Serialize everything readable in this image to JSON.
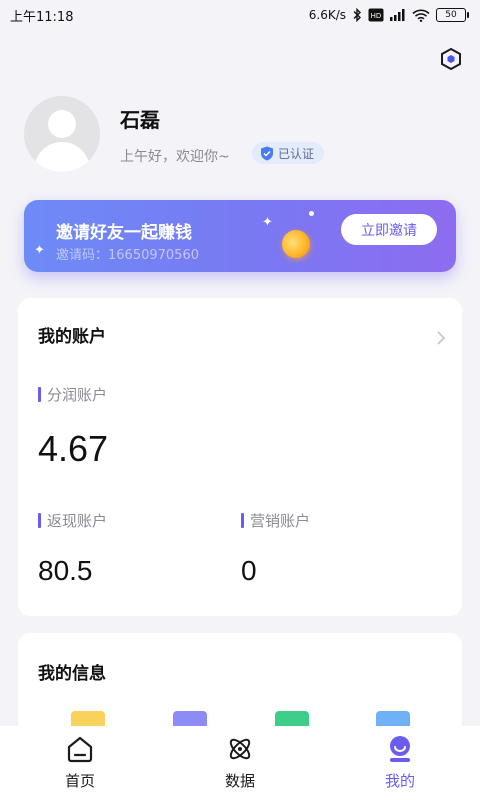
{
  "status_bar": {
    "time": "上午11:18",
    "net_speed": "6.6K/s",
    "battery": "50",
    "volte": "VoLTE"
  },
  "header": {
    "settings_icon": "hexagon-settings-icon"
  },
  "profile": {
    "name": "石磊",
    "greeting": "上午好，欢迎你~",
    "verified_label": "已认证"
  },
  "invite_banner": {
    "title": "邀请好友一起赚钱",
    "code": "邀请码：16650970560",
    "button_label": "立即邀请"
  },
  "accounts": {
    "title": "我的账户",
    "profit": {
      "label": "分润账户",
      "value": "4.67"
    },
    "cashback": {
      "label": "返现账户",
      "value": "80.5"
    },
    "marketing": {
      "label": "营销账户",
      "value": "0"
    }
  },
  "info": {
    "title": "我的信息"
  },
  "tabbar": {
    "items": [
      {
        "label": "首页",
        "icon": "home-icon"
      },
      {
        "label": "数据",
        "icon": "atom-icon"
      },
      {
        "label": "我的",
        "icon": "profile-face-icon"
      }
    ]
  },
  "colors": {
    "accent": "#6a5cf0",
    "banner_start": "#6d8bf6",
    "banner_end": "#8d6cf0",
    "page_bg": "#f3f3f8"
  }
}
